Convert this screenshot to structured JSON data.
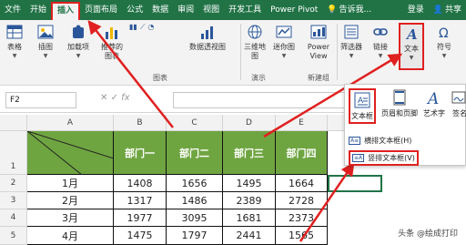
{
  "tabs": [
    "文件",
    "开始",
    "插入",
    "页面布局",
    "公式",
    "数据",
    "审阅",
    "视图",
    "开发工具",
    "Power Pivot"
  ],
  "active_tab": "插入",
  "tell_me": "告诉我...",
  "login": "登录",
  "share": "共享",
  "ribbon": {
    "table": "表格",
    "illustrations": "插图",
    "addins": "加载项",
    "recommended_charts": "推荐的图表",
    "pivot_chart": "数据透视图",
    "maps": "三维地图",
    "sparklines": "迷你图",
    "power_view": "Power View",
    "filters": "筛选器",
    "link": "链接",
    "text": "文本",
    "symbols": "符号",
    "group_charts": "图表",
    "group_tours": "演示",
    "group_reports": "新建组"
  },
  "formula_bar": {
    "name_box": "F2",
    "fx": "fx"
  },
  "columns": [
    "A",
    "B",
    "C",
    "D",
    "E"
  ],
  "rows": [
    "1",
    "2",
    "3",
    "4",
    "5"
  ],
  "table": {
    "headers": [
      "部门一",
      "部门二",
      "部门三",
      "部门四"
    ],
    "data": [
      [
        "1月",
        "1408",
        "1656",
        "1495",
        "1664"
      ],
      [
        "2月",
        "1317",
        "1486",
        "2389",
        "2728"
      ],
      [
        "3月",
        "1977",
        "3095",
        "1681",
        "2373"
      ],
      [
        "4月",
        "1475",
        "1797",
        "2441",
        "1565"
      ]
    ]
  },
  "popup": {
    "textbox": "文本框",
    "header_footer": "页眉和页脚",
    "wordart": "艺术字",
    "signature": "签名",
    "horizontal": "横排文本框(H)",
    "vertical": "竖排文本框(V)"
  },
  "watermark": "头条 @绘成打印",
  "colors": {
    "accent": "#217346",
    "header_green": "#6fa541",
    "highlight": "#e02020"
  }
}
